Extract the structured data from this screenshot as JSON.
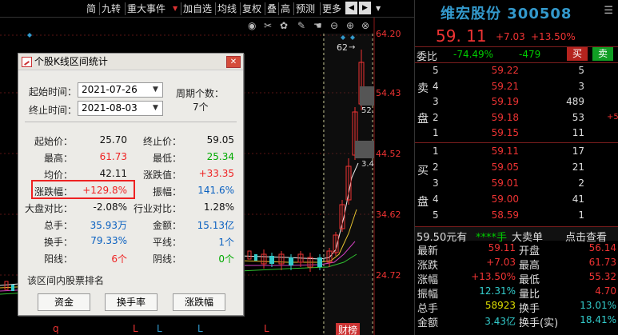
{
  "toolbar": {
    "items": [
      "简",
      "九转",
      "重大事件",
      "加自选",
      "均线",
      "复权",
      "叠",
      "高",
      "预测",
      "更多"
    ]
  },
  "chart": {
    "price_ticks": [
      "64.20",
      "54.43",
      "44.52",
      "34.62",
      "24.72"
    ],
    "top_annotation": "62",
    "mid_annotation_1": "52.",
    "mid_annotation_2": "3.4",
    "bottom_markers": [
      "q",
      "L",
      "L",
      "L",
      "L"
    ],
    "caibao_label": "财榜"
  },
  "dialog": {
    "title": "个股K线区间统计",
    "start_time_label": "起始时间：",
    "start_time_value": "2021-07-26",
    "end_time_label": "终止时间：",
    "end_time_value": "2021-08-03",
    "period_count_label": "周期个数：",
    "period_count_value": "7个",
    "stats_left": [
      {
        "label": "起始价：",
        "value": "25.70",
        "color": "black"
      },
      {
        "label": "最高：",
        "value": "61.73",
        "color": "red"
      },
      {
        "label": "均价：",
        "value": "42.11",
        "color": "black"
      },
      {
        "label": "涨跌幅：",
        "value": "+129.8%",
        "color": "red"
      },
      {
        "label": "大盘对比：",
        "value": "-2.08%",
        "color": "black"
      },
      {
        "label": "总手：",
        "value": "35.93万",
        "color": "blue"
      },
      {
        "label": "换手：",
        "value": "79.33%",
        "color": "blue"
      },
      {
        "label": "阳线：",
        "value": "6个",
        "color": "red"
      }
    ],
    "stats_right": [
      {
        "label": "终止价：",
        "value": "59.05",
        "color": "black"
      },
      {
        "label": "最低：",
        "value": "25.34",
        "color": "green"
      },
      {
        "label": "涨跌值：",
        "value": "+33.35",
        "color": "red"
      },
      {
        "label": "振幅：",
        "value": "141.6%",
        "color": "blue"
      },
      {
        "label": "行业对比：",
        "value": "1.28%",
        "color": "black"
      },
      {
        "label": "金额：",
        "value": "15.13亿",
        "color": "blue"
      },
      {
        "label": "平线：",
        "value": "1个",
        "color": "blue"
      },
      {
        "label": "阴线：",
        "value": "0个",
        "color": "green"
      }
    ],
    "rank_title": "该区间内股票排名",
    "buttons": [
      "资金",
      "换手率",
      "涨跌幅"
    ]
  },
  "quote": {
    "name_code": "维宏股份 300508",
    "last_price": "59. 11",
    "change": "+7.03",
    "change_pct": "+13.50%",
    "weibi_label": "委比",
    "weibi_value": "-74.49%",
    "weicha_value": "-479",
    "buy_button": "买",
    "sell_button": "卖",
    "ask_side_label": [
      "卖",
      "盘"
    ],
    "bid_side_label": [
      "买",
      "盘"
    ],
    "asks": [
      {
        "level": "5",
        "price": "59.22",
        "volume": "5",
        "extra": ""
      },
      {
        "level": "4",
        "price": "59.21",
        "volume": "3",
        "extra": ""
      },
      {
        "level": "3",
        "price": "59.19",
        "volume": "489",
        "extra": ""
      },
      {
        "level": "2",
        "price": "59.18",
        "volume": "53",
        "extra": "+5"
      },
      {
        "level": "1",
        "price": "59.15",
        "volume": "11",
        "extra": ""
      }
    ],
    "bids": [
      {
        "level": "1",
        "price": "59.11",
        "volume": "17"
      },
      {
        "level": "2",
        "price": "59.05",
        "volume": "21"
      },
      {
        "level": "3",
        "price": "59.01",
        "volume": "2"
      },
      {
        "level": "4",
        "price": "59.00",
        "volume": "41"
      },
      {
        "level": "5",
        "price": "58.59",
        "volume": "1"
      }
    ],
    "bar_price": "59.50元有",
    "bar_stars": "****手",
    "bar_trade": "大卖单",
    "bar_link": "点击查看",
    "stats": [
      {
        "label": "最新",
        "value": "59.11",
        "color": "red",
        "label2": "开盘",
        "value2": "56.14",
        "color2": "red"
      },
      {
        "label": "涨跌",
        "value": "+7.03",
        "color": "red",
        "label2": "最高",
        "value2": "61.73",
        "color2": "red"
      },
      {
        "label": "涨幅",
        "value": "+13.50%",
        "color": "red",
        "label2": "最低",
        "value2": "55.32",
        "color2": "red"
      },
      {
        "label": "振幅",
        "value": "12.31%",
        "color": "cyan",
        "label2": "量比",
        "value2": "4.70",
        "color2": "red"
      },
      {
        "label": "总手",
        "value": "58923",
        "color": "yellow",
        "label2": "换手",
        "value2": "13.01%",
        "color2": "cyan"
      },
      {
        "label": "金额",
        "value": "3.43亿",
        "color": "cyan",
        "label2": "换手(实)",
        "value2": "18.41%",
        "color2": "cyan"
      }
    ]
  }
}
